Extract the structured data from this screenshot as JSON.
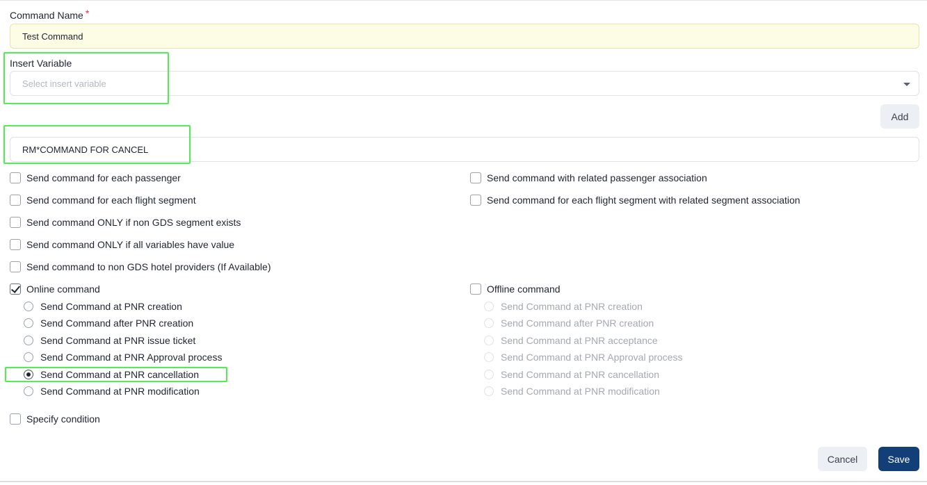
{
  "form": {
    "command_name_label": "Command Name",
    "required_mark": "*",
    "command_name_value": "Test Command",
    "insert_variable_label": "Insert Variable",
    "insert_variable_placeholder": "Select insert variable",
    "add_button": "Add",
    "command_text_value": "RM*COMMAND FOR CANCEL"
  },
  "options": {
    "left": [
      {
        "label": "Send command for each passenger",
        "checked": false
      },
      {
        "label": "Send command for each flight segment",
        "checked": false
      },
      {
        "label": "Send command ONLY if non GDS segment exists",
        "checked": false
      },
      {
        "label": "Send command ONLY if all variables have value",
        "checked": false
      },
      {
        "label": "Send command to non GDS hotel providers (If Available)",
        "checked": false
      }
    ],
    "right": [
      {
        "label": "Send command with related passenger association",
        "checked": false
      },
      {
        "label": "Send command for each flight segment with related segment association",
        "checked": false
      }
    ]
  },
  "online": {
    "label": "Online command",
    "checked": true,
    "radios": [
      {
        "label": "Send Command at PNR creation",
        "selected": false
      },
      {
        "label": "Send Command after PNR creation",
        "selected": false
      },
      {
        "label": "Send Command at PNR issue ticket",
        "selected": false
      },
      {
        "label": "Send Command at PNR Approval process",
        "selected": false
      },
      {
        "label": "Send Command at PNR cancellation",
        "selected": true
      },
      {
        "label": "Send Command at PNR modification",
        "selected": false
      }
    ]
  },
  "offline": {
    "label": "Offline command",
    "checked": false,
    "radios": [
      {
        "label": "Send Command at PNR creation",
        "selected": false
      },
      {
        "label": "Send Command after PNR creation",
        "selected": false
      },
      {
        "label": "Send Command at PNR acceptance",
        "selected": false
      },
      {
        "label": "Send Command at PNR Approval process",
        "selected": false
      },
      {
        "label": "Send Command at PNR cancellation",
        "selected": false
      },
      {
        "label": "Send Command at PNR modification",
        "selected": false
      }
    ]
  },
  "condition": {
    "label": "Specify condition",
    "checked": false
  },
  "footer": {
    "cancel_label": "Cancel",
    "save_label": "Save"
  },
  "colors": {
    "primary": "#123f77",
    "highlight": "#5ce65c",
    "required": "#e0303b"
  }
}
